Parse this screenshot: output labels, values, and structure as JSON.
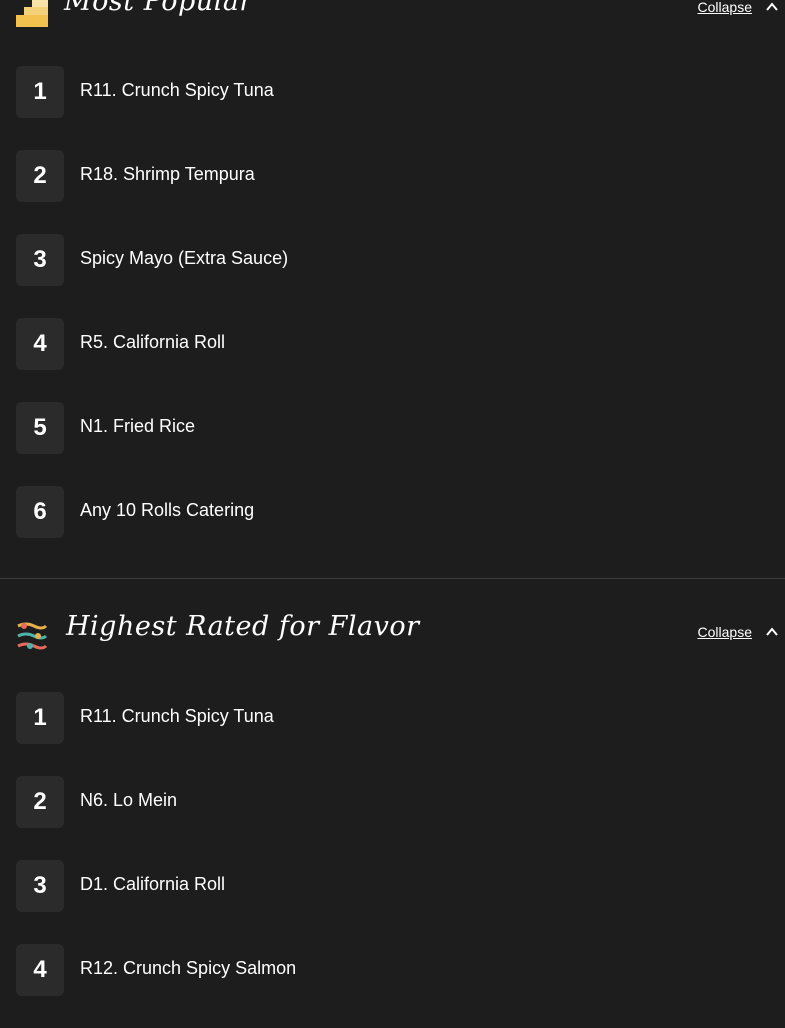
{
  "sections": [
    {
      "title": "Most Popular",
      "icon": "stairs-icon",
      "collapse_label": "Collapse",
      "items": [
        {
          "rank": "1",
          "name": "R11. Crunch Spicy Tuna"
        },
        {
          "rank": "2",
          "name": "R18. Shrimp Tempura"
        },
        {
          "rank": "3",
          "name": "Spicy Mayo (Extra Sauce)"
        },
        {
          "rank": "4",
          "name": "R5. California Roll"
        },
        {
          "rank": "5",
          "name": "N1. Fried Rice"
        },
        {
          "rank": "6",
          "name": "Any 10 Rolls Catering"
        }
      ]
    },
    {
      "title": "Highest Rated for Flavor",
      "icon": "flavor-sliders-icon",
      "collapse_label": "Collapse",
      "items": [
        {
          "rank": "1",
          "name": "R11. Crunch Spicy Tuna"
        },
        {
          "rank": "2",
          "name": "N6. Lo Mein"
        },
        {
          "rank": "3",
          "name": "D1. California Roll"
        },
        {
          "rank": "4",
          "name": "R12. Crunch Spicy Salmon"
        }
      ]
    }
  ],
  "colors": {
    "background": "#1d1d1d",
    "rank_box": "#2b2b2b",
    "divider": "#3d3d3d",
    "text": "#ffffff"
  }
}
